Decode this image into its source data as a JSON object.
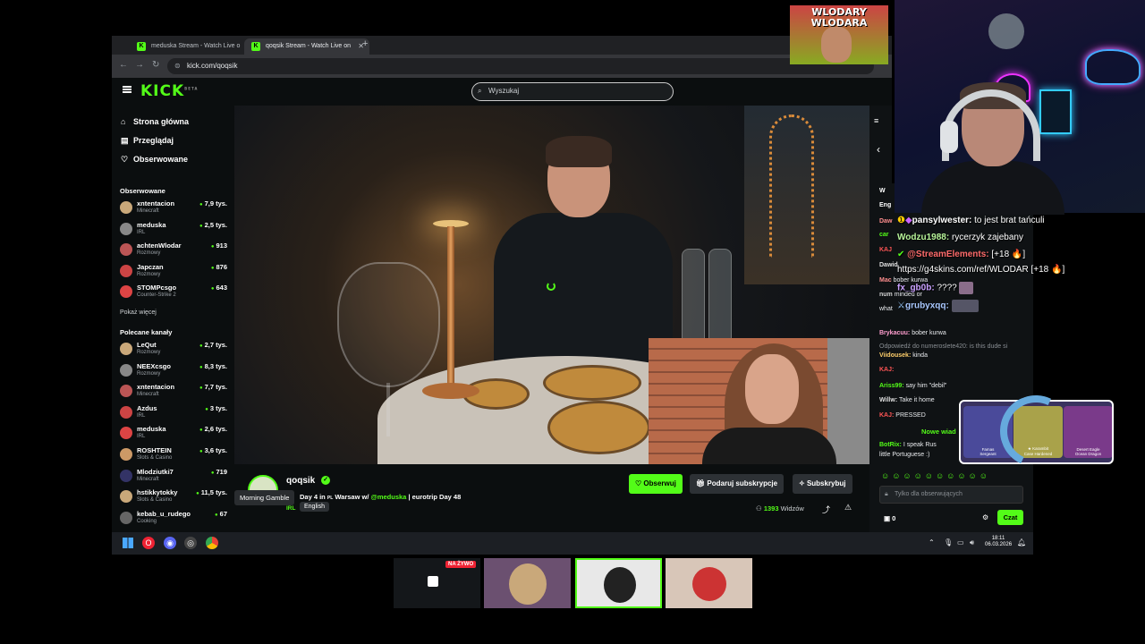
{
  "browser": {
    "tabs": [
      {
        "label": "meduska Stream - Watch Live o",
        "active": false
      },
      {
        "label": "qoqsik Stream - Watch Live on",
        "active": true
      }
    ],
    "url": "kick.com/qoqsik"
  },
  "header": {
    "logo": "KICK",
    "logo_beta": "BETA",
    "search_placeholder": "Wyszukaj"
  },
  "nav": [
    {
      "label": "Strona główna",
      "icon": "home-icon",
      "glyph": "⌂"
    },
    {
      "label": "Przeglądaj",
      "icon": "browse-icon",
      "glyph": "▤"
    },
    {
      "label": "Obserwowane",
      "icon": "heart-icon",
      "glyph": "♡"
    }
  ],
  "followed": {
    "title": "Obserwowane",
    "items": [
      {
        "name": "xntentacion",
        "category": "Minecraft",
        "viewers": "7,9 tys."
      },
      {
        "name": "meduska",
        "category": "IRL",
        "viewers": "2,5 tys."
      },
      {
        "name": "achtenWlodar",
        "category": "Rozmowy",
        "viewers": "913"
      },
      {
        "name": "Japczan",
        "category": "Rozmowy",
        "viewers": "876"
      },
      {
        "name": "STOMPcsgo",
        "category": "Counter-Strike 2",
        "viewers": "643"
      }
    ],
    "show_more": "Pokaż więcej"
  },
  "recommended": {
    "title": "Polecane kanały",
    "items": [
      {
        "name": "LeQut",
        "category": "Rozmowy",
        "viewers": "2,7 tys."
      },
      {
        "name": "NEEXcsgo",
        "category": "Rozmowy",
        "viewers": "8,3 tys."
      },
      {
        "name": "xntentacion",
        "category": "Minecraft",
        "viewers": "7,7 tys."
      },
      {
        "name": "Azdus",
        "category": "IRL",
        "viewers": "3 tys."
      },
      {
        "name": "meduska",
        "category": "IRL",
        "viewers": "2,6 tys."
      },
      {
        "name": "ROSHTEIN",
        "category": "Slots & Casino",
        "viewers": "3,6 tys."
      },
      {
        "name": "Mlodziutki7",
        "category": "Minecraft",
        "viewers": "719"
      },
      {
        "name": "hstikkytokky",
        "category": "Slots & Casino",
        "viewers": "11,5 tys."
      },
      {
        "name": "kebab_u_rudego",
        "category": "Cooking",
        "viewers": "67"
      }
    ]
  },
  "stream": {
    "streamer": "qoqsik",
    "title_pre": "Day 4 in",
    "title_flag": "PL",
    "title_mid": "Warsaw w/",
    "title_mention": "@meduska",
    "title_post": "| eurotrip Day 48",
    "category": "IRL",
    "language": "English",
    "tooltip": "Morning Gamble",
    "follow_label": "Obserwuj",
    "gift_label": "Podaruj subskrypcje",
    "subscribe_label": "Subskrybuj",
    "viewers": "1393",
    "viewers_label": "Widzów"
  },
  "chat": {
    "messages": [
      {
        "user": "Daw",
        "text": ""
      },
      {
        "user": "car",
        "text": ""
      },
      {
        "user": "KAJ",
        "text": ""
      },
      {
        "user": "Dawid",
        "text": ""
      },
      {
        "user": "Mac",
        "text": "bober kurwa"
      },
      {
        "user": "num",
        "text": "minded or"
      },
      {
        "user": "",
        "text": "what"
      },
      {
        "user": "Brykacuu:",
        "text": "bober kurwa"
      },
      {
        "user": "",
        "text": "Odpowiedź do numeroslete420: is this dude si"
      },
      {
        "user": "Viidousek:",
        "text": "kinda"
      },
      {
        "user": "KAJ:",
        "text": ""
      },
      {
        "user": "Ariss99:",
        "text": "say him \"debil\""
      },
      {
        "user": "Willw:",
        "text": "Take it home"
      },
      {
        "user": "KAJ:",
        "text": "PRESSED"
      }
    ],
    "new_messages": "Nowe wiad",
    "bot_user": "BotRix:",
    "bot_text": "I speak Rus",
    "bot_text2": "little Portuguese :)",
    "input_placeholder": "Tylko dla obserwujących",
    "count": "0",
    "send_label": "Czat",
    "header_snip": "W",
    "header_lang": "Eng"
  },
  "overlay_chat": [
    {
      "user": "pansylwester:",
      "text": "to jest brat tańculi",
      "color": "#ffffff"
    },
    {
      "user": "Wodzu1988:",
      "text": "rycerzyk zajebany",
      "color": "#b8f59a"
    },
    {
      "user": "@StreamElements:",
      "text": "[+18 🔥]",
      "color": "#ff6b6b"
    },
    {
      "user": "",
      "text": "https://g4skins.com/ref/WLODAR [+18 🔥]",
      "color": "#ffffff"
    },
    {
      "user": "fx_gb0b:",
      "text": "????",
      "color": "#c9a0ff"
    },
    {
      "user": "grubyxqq:",
      "text": "",
      "color": "#a9c8ff"
    }
  ],
  "wlodar_logo": "WLODARY WLODARA",
  "skins": [
    {
      "label": "Famas",
      "sub": "Sergeant"
    },
    {
      "label": "★ Karambit",
      "sub": "Case Hardened"
    },
    {
      "label": "Desert Eagle",
      "sub": "Ocean Dragon"
    }
  ],
  "taskbar": {
    "time": "18:11",
    "date": "06.03.2026"
  },
  "thumbnails": {
    "live_label": "NA ŻYWO"
  },
  "colors": {
    "accent": "#53fc18",
    "background": "#0b0e0f"
  }
}
